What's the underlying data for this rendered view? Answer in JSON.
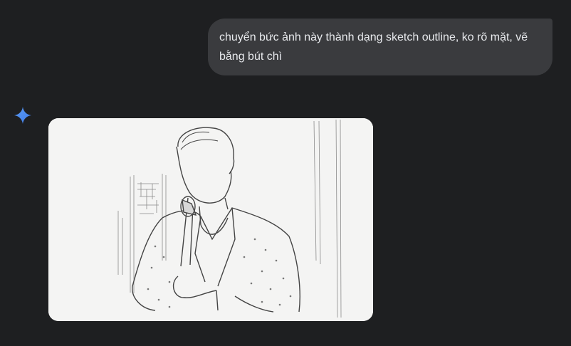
{
  "conversation": {
    "user_message": "chuyển bức ảnh này thành dạng sketch outline, ko rõ mặt, vẽ bằng bút chì"
  },
  "response": {
    "assistant_icon": "gemini-spark-icon",
    "image_icon": "pencil-sketch-image"
  },
  "colors": {
    "background": "#1e1f21",
    "user_bubble": "#3a3b3e",
    "spark": "#4f8ef7"
  }
}
